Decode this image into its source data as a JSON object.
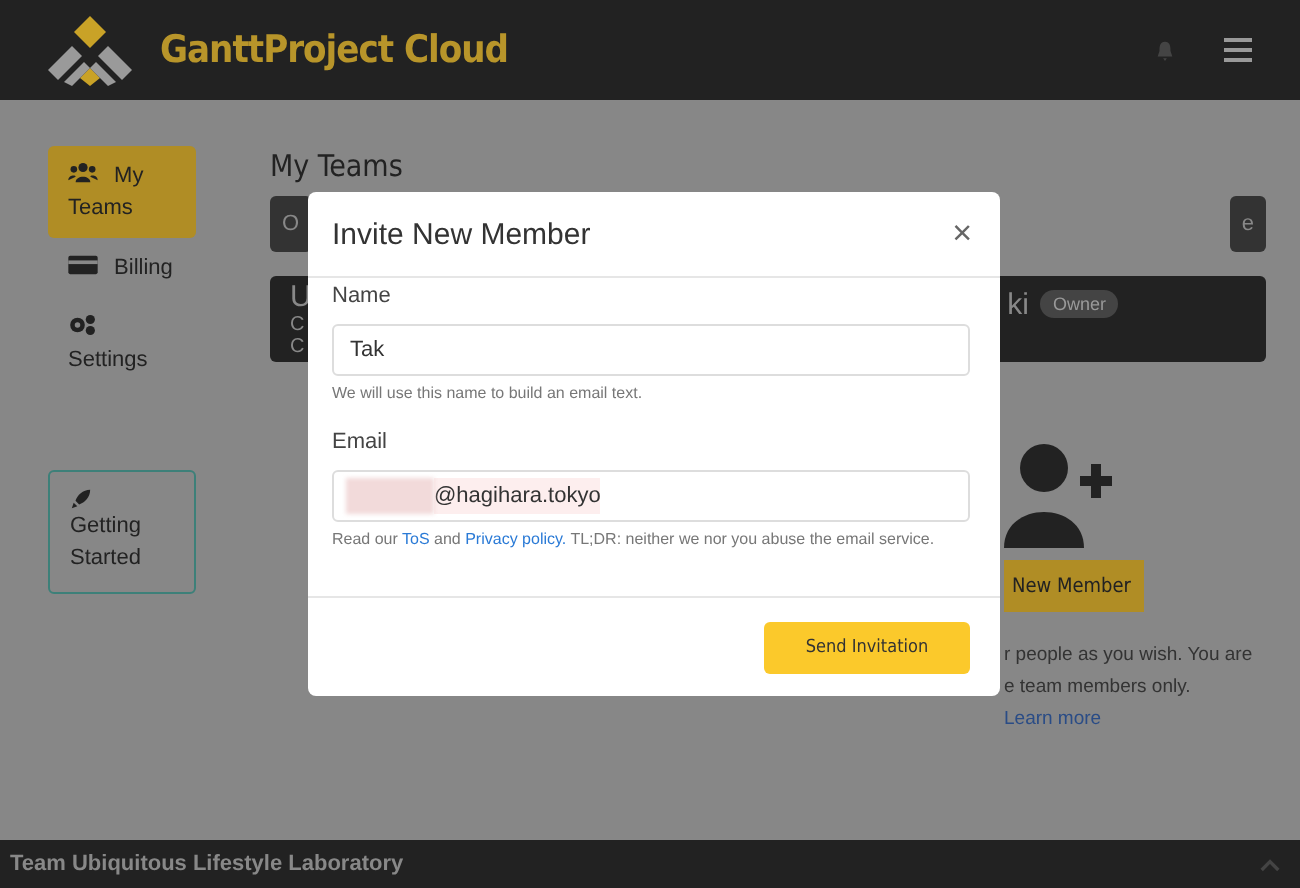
{
  "header": {
    "brand": "GanttProject Cloud"
  },
  "sidebar": {
    "items": [
      {
        "label": "My Teams",
        "selected": true
      },
      {
        "label": "Billing",
        "selected": false
      },
      {
        "label": "Settings",
        "selected": false
      }
    ],
    "getting_started": "Getting Started"
  },
  "main": {
    "title": "My Teams",
    "tab_left": "O",
    "tab_right": "e",
    "card": {
      "lines": [
        "U",
        "C",
        "C"
      ],
      "member": "ki",
      "badge": "Owner"
    },
    "new_member_button": "New Member",
    "info_lines": [
      "r people as you wish. You are",
      "e team members only."
    ],
    "learn_more": "Learn more"
  },
  "modal": {
    "title": "Invite New Member",
    "close": "×",
    "name": {
      "label": "Name",
      "value": "Tak",
      "hint": "We will use this name to build an email text."
    },
    "email": {
      "label": "Email",
      "value": "@hagihara.tokyo",
      "hint_parts": [
        {
          "kind": "text",
          "text": "Read our "
        },
        {
          "kind": "link",
          "text": "ToS"
        },
        {
          "kind": "text",
          "text": " and "
        },
        {
          "kind": "link",
          "text": "Privacy policy."
        },
        {
          "kind": "text",
          "text": " TL;DR: neither we nor you abuse the email service."
        }
      ]
    },
    "submit": "Send Invitation"
  },
  "footer": {
    "team": "Team Ubiquitous Lifestyle Laboratory"
  }
}
